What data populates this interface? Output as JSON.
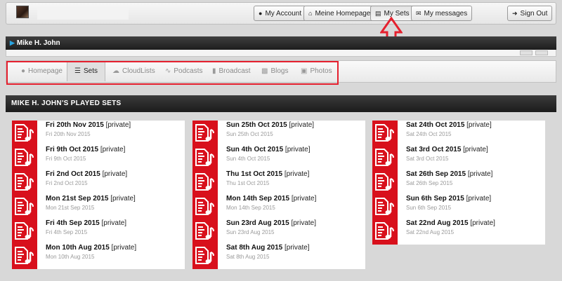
{
  "topbar": {
    "buttons": [
      {
        "icon": "user-icon",
        "label": "My Account"
      },
      {
        "icon": "home-icon",
        "label": "Meine Homepage"
      },
      {
        "icon": "list-icon",
        "label": "My Sets"
      },
      {
        "icon": "envelope-icon",
        "label": "My messages"
      },
      {
        "icon": "sign-out-icon",
        "label": "Sign Out"
      }
    ]
  },
  "profile": {
    "name": "Mike H. John"
  },
  "tabs": [
    {
      "icon": "user-icon",
      "label": "Homepage"
    },
    {
      "icon": "list-icon",
      "label": "Sets"
    },
    {
      "icon": "cloud-icon",
      "label": "CloudLists"
    },
    {
      "icon": "rss-icon",
      "label": "Podcasts"
    },
    {
      "icon": "microphone-icon",
      "label": "Broadcast"
    },
    {
      "icon": "book-icon",
      "label": "Blogs"
    },
    {
      "icon": "photo-icon",
      "label": "Photos"
    }
  ],
  "section": {
    "title": "MIKE H. JOHN'S PLAYED SETS"
  },
  "colors": {
    "accent_red": "#d8101c",
    "highlight_red": "#e5202e",
    "dark_bar": "#1e1e1e"
  },
  "sets": [
    [
      {
        "title": "Fri 20th Nov 2015",
        "privacy": "[private]",
        "date": "Fri 20th Nov 2015"
      },
      {
        "title": "Fri 9th Oct 2015",
        "privacy": "[private]",
        "date": "Fri 9th Oct 2015"
      },
      {
        "title": "Fri 2nd Oct 2015",
        "privacy": "[private]",
        "date": "Fri 2nd Oct 2015"
      },
      {
        "title": "Mon 21st Sep 2015",
        "privacy": "[private]",
        "date": "Mon 21st Sep 2015"
      },
      {
        "title": "Fri 4th Sep 2015",
        "privacy": "[private]",
        "date": "Fri 4th Sep 2015"
      },
      {
        "title": "Mon 10th Aug 2015",
        "privacy": "[private]",
        "date": "Mon 10th Aug 2015"
      }
    ],
    [
      {
        "title": "Sun 25th Oct 2015",
        "privacy": "[private]",
        "date": "Sun 25th Oct 2015"
      },
      {
        "title": "Sun 4th Oct 2015",
        "privacy": "[private]",
        "date": "Sun 4th Oct 2015"
      },
      {
        "title": "Thu 1st Oct 2015",
        "privacy": "[private]",
        "date": "Thu 1st Oct 2015"
      },
      {
        "title": "Mon 14th Sep 2015",
        "privacy": "[private]",
        "date": "Mon 14th Sep 2015"
      },
      {
        "title": "Sun 23rd Aug 2015",
        "privacy": "[private]",
        "date": "Sun 23rd Aug 2015"
      },
      {
        "title": "Sat 8th Aug 2015",
        "privacy": "[private]",
        "date": "Sat 8th Aug 2015"
      }
    ],
    [
      {
        "title": "Sat 24th Oct 2015",
        "privacy": "[private]",
        "date": "Sat 24th Oct 2015"
      },
      {
        "title": "Sat 3rd Oct 2015",
        "privacy": "[private]",
        "date": "Sat 3rd Oct 2015"
      },
      {
        "title": "Sat 26th Sep 2015",
        "privacy": "[private]",
        "date": "Sat 26th Sep 2015"
      },
      {
        "title": "Sun 6th Sep 2015",
        "privacy": "[private]",
        "date": "Sun 6th Sep 2015"
      },
      {
        "title": "Sat 22nd Aug 2015",
        "privacy": "[private]",
        "date": "Sat 22nd Aug 2015"
      }
    ]
  ]
}
